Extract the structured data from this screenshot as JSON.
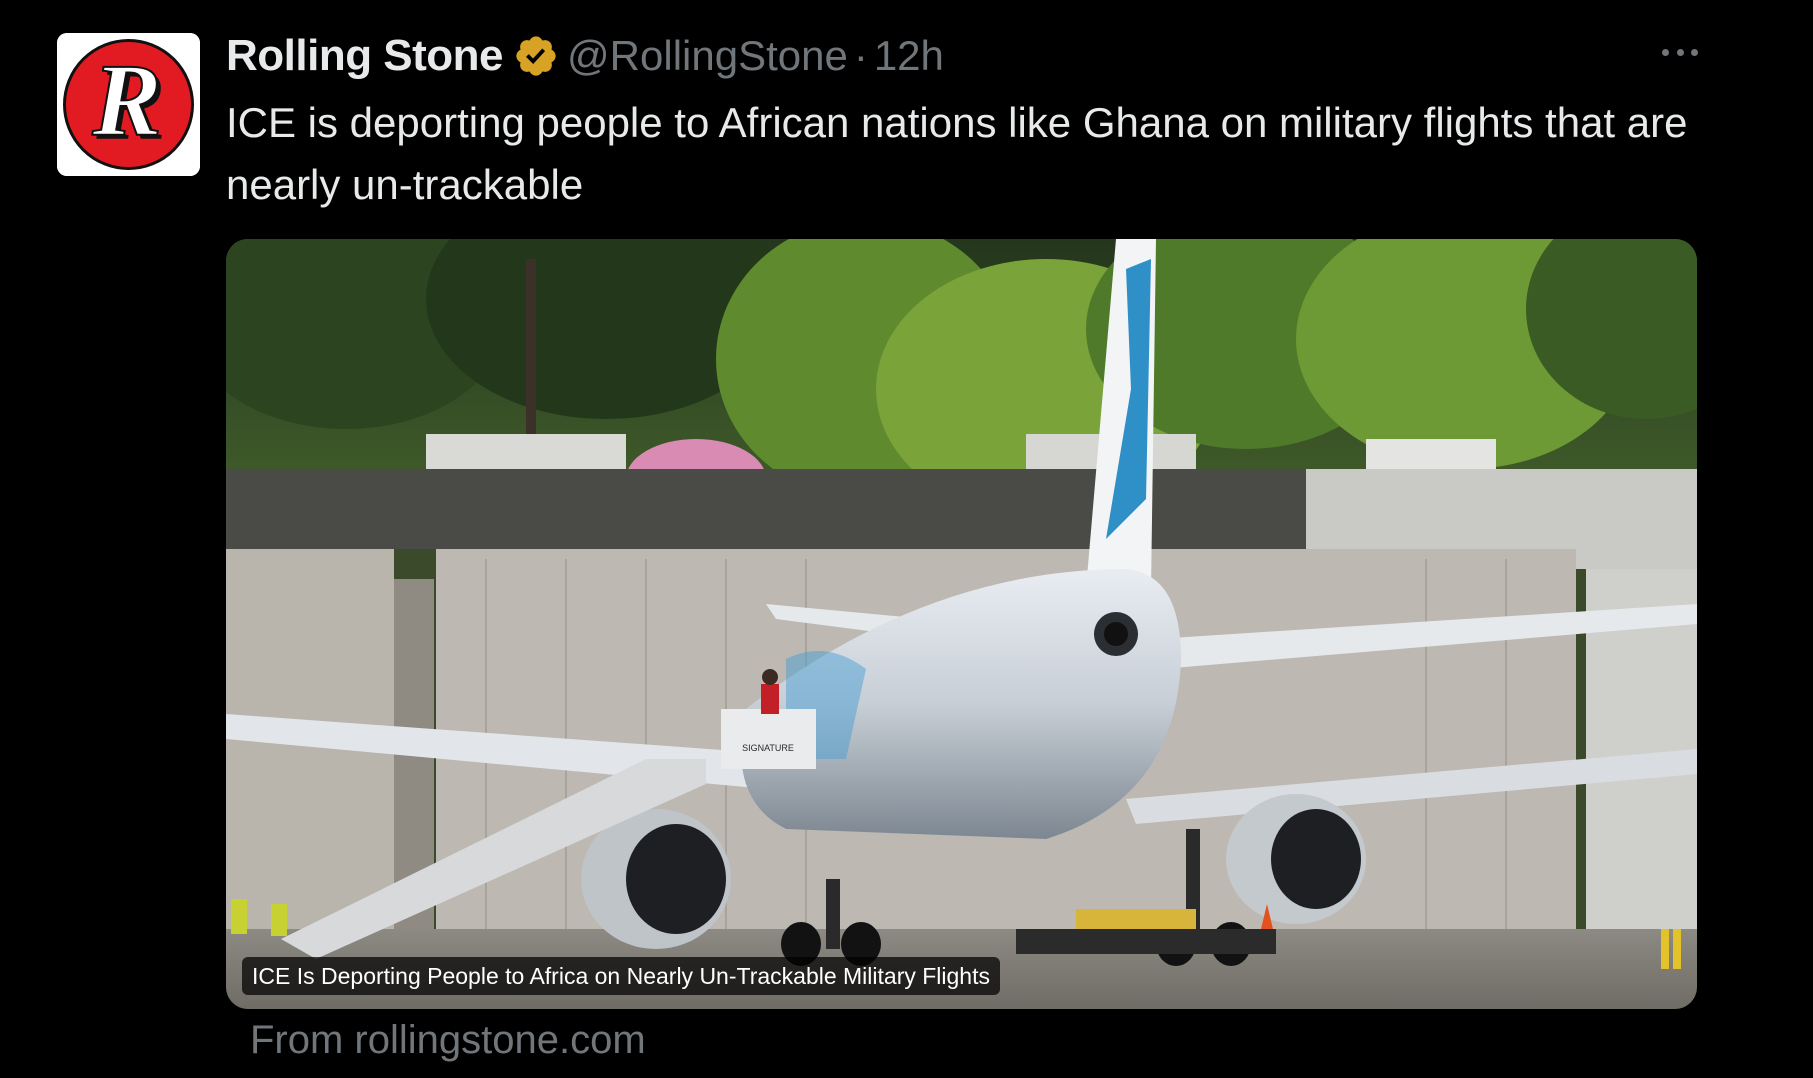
{
  "author": {
    "display_name": "Rolling Stone",
    "handle": "@RollingStone",
    "separator": "·",
    "time": "12h",
    "avatar_letter": "R",
    "verified_icon": "verified-badge-icon",
    "verified_color": "#d8a325"
  },
  "tweet": {
    "text": "ICE is deporting people to African nations like Ghana on military flights that are nearly un-trackable"
  },
  "card": {
    "title": "ICE Is Deporting People to Africa on Nearly Un-Trackable Military Flights",
    "source": "From rollingstone.com",
    "image_icon": "airplane-photo",
    "stair_sign": "SIGNATURE"
  },
  "actions": {
    "more_icon": "more-options-icon"
  },
  "colors": {
    "background": "#000000",
    "text_primary": "#e7e9ea",
    "text_secondary": "#71767b",
    "avatar_red": "#e21b23"
  }
}
